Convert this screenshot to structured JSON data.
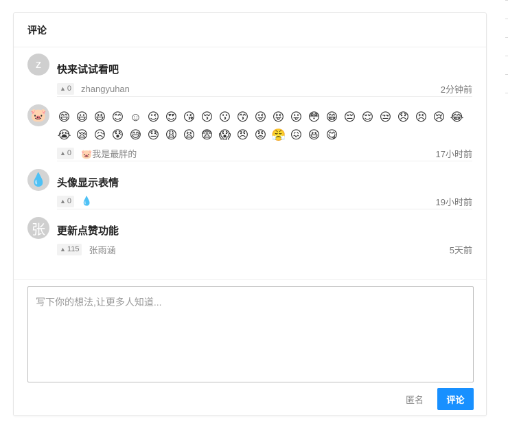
{
  "header": {
    "title": "评论"
  },
  "comments": [
    {
      "avatar": "z",
      "title": "快来试试看吧",
      "votes": "0",
      "author": "zhangyuhan",
      "time": "2分钟前"
    },
    {
      "avatar": "🐷",
      "emojis": [
        "😄",
        "😃",
        "😆",
        "😊",
        "☺",
        "😉",
        "😍",
        "😘",
        "😚",
        "😗",
        "😙",
        "😜",
        "😝",
        "😛",
        "😳",
        "😁",
        "😔",
        "😌",
        "😒",
        "😞",
        "😣",
        "😢",
        "😂",
        "😭",
        "😪",
        "😥",
        "😰",
        "😅",
        "😓",
        "😩",
        "😫",
        "😨",
        "😱",
        "😠",
        "😡",
        "😤",
        "😖",
        "😆",
        "😋"
      ],
      "votes": "0",
      "author": "🐷我是最胖的",
      "time": "17小时前"
    },
    {
      "avatar": "💧",
      "title": "头像显示表情",
      "votes": "0",
      "author": "💧",
      "time": "19小时前"
    },
    {
      "avatar": "张",
      "title": "更新点赞功能",
      "votes": "115",
      "author": "张雨涵",
      "time": "5天前"
    }
  ],
  "composer": {
    "placeholder": "写下你的想法,让更多人知道...",
    "anonymous_label": "匿名",
    "submit_label": "评论"
  },
  "icons": {
    "vote": "triangle-up-icon"
  },
  "colors": {
    "accent": "#1890ff"
  }
}
